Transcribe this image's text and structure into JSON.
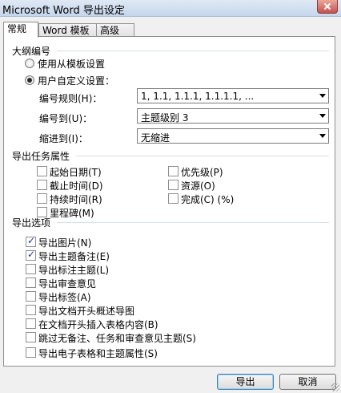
{
  "window": {
    "title": "Microsoft Word 导出设定"
  },
  "tabs": [
    {
      "label": "常规",
      "active": true
    },
    {
      "label": "Word 模板",
      "active": false
    },
    {
      "label": "高级",
      "active": false
    }
  ],
  "outline": {
    "group_label": "大纲编号",
    "radio_template": "使用从模板设置",
    "radio_custom": "用户自定义设置：",
    "selected": "custom",
    "numbering_rule_label": "编号规则(H)：",
    "numbering_rule_value": "1,  1.1,  1.1.1,  1.1.1.1,  ...",
    "number_to_label": "编号到(U)：",
    "number_to_value": "主题级别 3",
    "indent_to_label": "缩进到(I)：",
    "indent_to_value": "无缩进"
  },
  "task_props": {
    "group_label": "导出任务属性",
    "items": {
      "start_date": {
        "label": "起始日期(T)",
        "checked": false
      },
      "deadline": {
        "label": "截止时间(D)",
        "checked": false
      },
      "duration": {
        "label": "持续时间(R)",
        "checked": false
      },
      "milestone": {
        "label": "里程碑(M)",
        "checked": false
      },
      "priority": {
        "label": "优先级(P)",
        "checked": false
      },
      "resource": {
        "label": "资源(O)",
        "checked": false
      },
      "complete": {
        "label": "完成(C) (%)",
        "checked": false
      }
    }
  },
  "export_options": {
    "group_label": "导出选项",
    "items": [
      {
        "label": "导出图片(N)",
        "checked": true
      },
      {
        "label": "导出主题备注(E)",
        "checked": true
      },
      {
        "label": "导出标注主题(L)",
        "checked": false
      },
      {
        "label": "导出审查意见",
        "checked": false
      },
      {
        "label": "导出标签(A)",
        "checked": false
      },
      {
        "label": "导出文档开头概述导图",
        "checked": false
      },
      {
        "label": "在文档开头插入表格内容(B)",
        "checked": false
      },
      {
        "label": "跳过无备注、任务和审查意见主题(S)",
        "checked": false
      },
      {
        "label": "导出电子表格和主题属性(S)",
        "checked": false
      }
    ]
  },
  "buttons": {
    "export": "导出",
    "cancel": "取消"
  }
}
